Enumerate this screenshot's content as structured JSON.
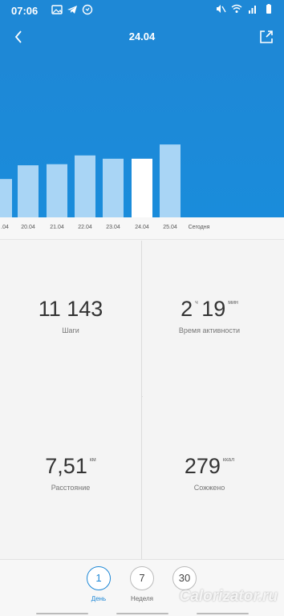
{
  "status": {
    "time": "07:06",
    "battery_icon": "battery-icon",
    "wifi_icon": "wifi-icon"
  },
  "header": {
    "title": "24.04",
    "back_icon": "back-icon",
    "share_icon": "share-icon"
  },
  "chart_data": {
    "type": "bar",
    "categories": [
      ".04",
      "20.04",
      "21.04",
      "22.04",
      "23.04",
      "24.04",
      "25.04",
      "Сегодня"
    ],
    "values": [
      7000,
      9500,
      9700,
      11300,
      10700,
      10700,
      13300,
      0
    ],
    "selected": "24.04",
    "colors": {
      "bar": "#a9d5f5",
      "selected": "#ffffff",
      "background": "#1e88d6"
    }
  },
  "metrics": {
    "steps": {
      "value": "11 143",
      "unit": "",
      "label": "Шаги"
    },
    "active": {
      "hours": "2",
      "hours_unit": "ч",
      "minutes": "19",
      "minutes_unit": "мин",
      "label": "Время активности"
    },
    "distance": {
      "value": "7,51",
      "unit": "км",
      "label": "Расстояние"
    },
    "burned": {
      "value": "279",
      "unit": "ккал",
      "label": "Сожжено"
    }
  },
  "periods": [
    {
      "value": "1",
      "label": "День",
      "active": true
    },
    {
      "value": "7",
      "label": "Неделя",
      "active": false
    },
    {
      "value": "30",
      "label": "",
      "active": false
    }
  ],
  "watermark": "Calorizator.ru"
}
